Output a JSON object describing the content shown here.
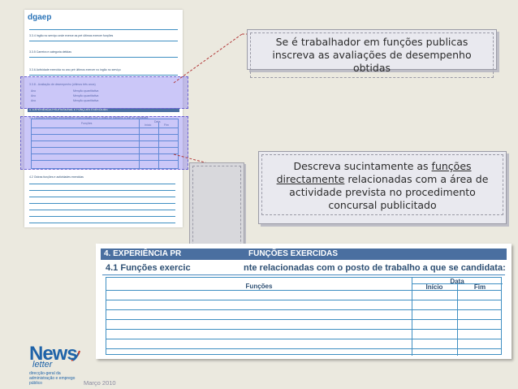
{
  "thumbnail": {
    "logo": "dgaep",
    "lines": [
      "3.3.4 Ingão no serviço onde exerce as pré últimos exercer funções",
      "3.3.5 Carreira e categoria detidas",
      "3.3.6 Actividade exercida no ano pré últimos exercer no ingão no serviço",
      "3.3.8 - Avaliação de desempenho (últimos três anos)",
      "4. EXPERIÊNCIA PROFISSIONAL E FUNÇÕES EXERCIDAS",
      "4.1 Funções exercidas directamente relacionadas com o posto de trabalho a que se candidata",
      "4.2 Outras funções e actividades exercidas"
    ],
    "eval_rows": [
      {
        "label": "Ano",
        "field": "Menção quantitativa"
      },
      {
        "label": "Ano",
        "field": "Menção quantitativa"
      },
      {
        "label": "Ano",
        "field": "Menção quantitativa"
      }
    ],
    "table_headers": {
      "functions": "Funções",
      "date": "Data",
      "start": "Início",
      "end": "Fim"
    }
  },
  "callout1": {
    "text": "Se é trabalhador em funções publicas inscreva as avaliações de desempenho obtidas"
  },
  "callout2": {
    "text_before": "Descreva sucintamente as ",
    "underlined1": "funções",
    "space": " ",
    "underlined2": "directamente",
    "text_after": " relacionadas com a área de actividade prevista no procedimento concursal publicitado"
  },
  "zoomed_table": {
    "section_title": "4. EXPERIÊNCIA PR",
    "section_title_end": "FUNÇÕES EXERCIDAS",
    "subtitle_start": "4.1 Funções exercic",
    "subtitle_end": "nte relacionadas com o posto de trabalho a que se candidata:",
    "col_functions": "Funções",
    "col_date": "Data",
    "col_start": "Início",
    "col_end": "Fim",
    "rows": 7
  },
  "branding": {
    "name": "News",
    "name2": "letter",
    "tagline": "direcção-geral da administração e emprego público",
    "date": "Março 2010"
  },
  "colors": {
    "background": "#ebe9df",
    "accent_blue": "#4a6fa0",
    "line_blue": "#3f8fc2",
    "overlay": "#8c82f0"
  }
}
